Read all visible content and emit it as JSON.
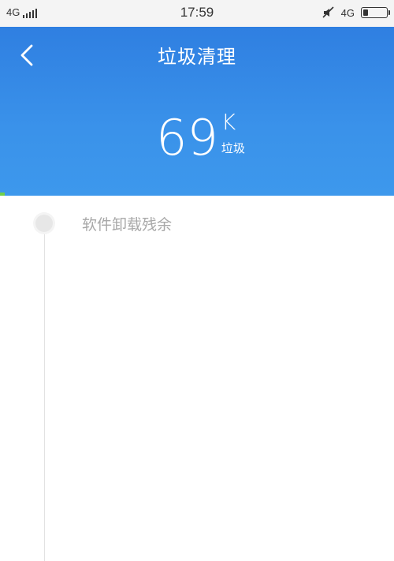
{
  "status_bar": {
    "network_left": "4G",
    "time": "17:59",
    "network_right": "4G"
  },
  "header": {
    "title": "垃圾清理",
    "junk_amount": "69",
    "junk_unit": "K",
    "junk_label": "垃圾"
  },
  "list": {
    "items": [
      {
        "label": "软件卸载残余"
      }
    ]
  },
  "colors": {
    "header_top": "#2f7fe1",
    "header_bottom": "#3d98ec",
    "progress_accent": "#6fd04a"
  }
}
